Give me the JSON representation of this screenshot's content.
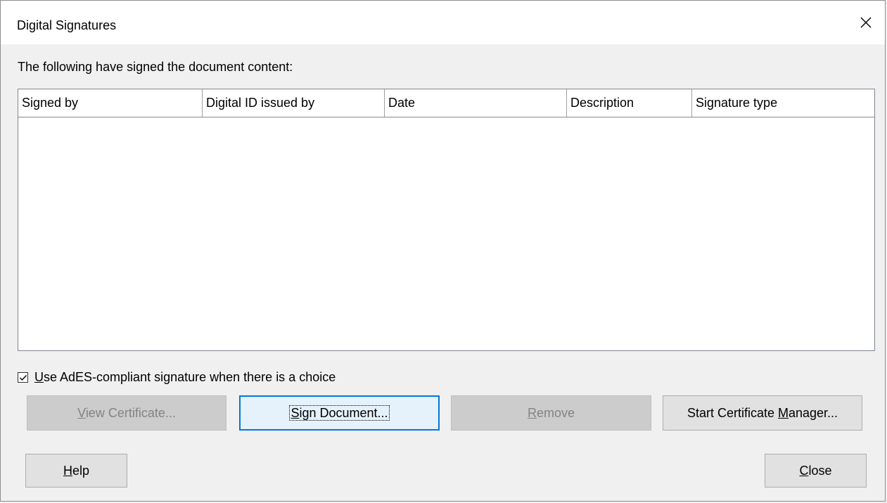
{
  "window": {
    "title": "Digital Signatures"
  },
  "caption": "The following have signed the document content:",
  "table": {
    "columns": [
      "Signed by",
      "Digital ID issued by",
      "Date",
      "Description",
      "Signature type"
    ],
    "rows": []
  },
  "checkbox": {
    "checked": true,
    "label_underlined": "U",
    "label_rest": "se AdES-compliant signature when there is a choice"
  },
  "buttons": {
    "view_certificate": {
      "underlined": "V",
      "rest": "iew Certificate...",
      "enabled": false
    },
    "sign_document": {
      "underlined": "S",
      "rest": "ign Document...",
      "enabled": true,
      "focused": true
    },
    "remove": {
      "underlined": "R",
      "rest": "emove",
      "enabled": false
    },
    "start_cert_manager": {
      "before": "Start Certificate ",
      "underlined": "M",
      "after": "anager...",
      "enabled": true
    },
    "help": {
      "underlined": "H",
      "rest": "elp"
    },
    "close": {
      "underlined": "C",
      "rest": "lose"
    }
  },
  "icons": {
    "close": "close-x-icon",
    "check": "checkmark-icon"
  },
  "colors": {
    "focus_border": "#0078d7",
    "disabled_bg": "#cccccc",
    "disabled_text": "#838383"
  }
}
